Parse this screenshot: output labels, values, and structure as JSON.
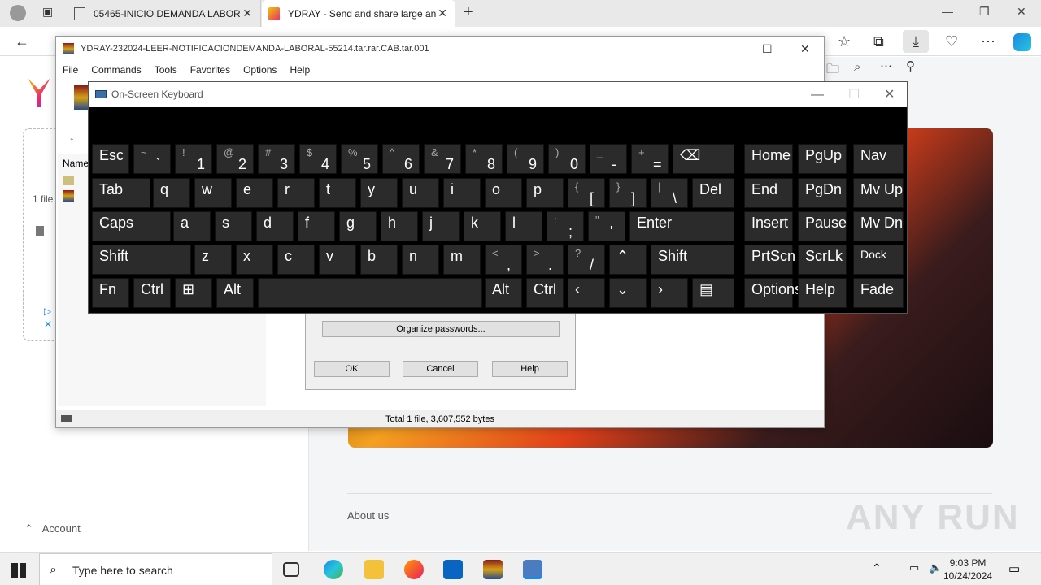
{
  "browser": {
    "tabs": [
      {
        "label": "05465-INICIO DEMANDA LABOR"
      },
      {
        "label": "YDRAY - Send and share large an"
      }
    ]
  },
  "page": {
    "about": "About us",
    "account": "Account",
    "file_count": "1 file",
    "watermark": "ANY RUN"
  },
  "winrar": {
    "title": "YDRAY-232024-LEER-NOTIFICACIONDEMANDA-LABORAL-55214.tar.rar.CAB.tar.001",
    "menu": [
      "File",
      "Commands",
      "Tools",
      "Favorites",
      "Options",
      "Help"
    ],
    "status": "Total 1 file, 3,607,552 bytes",
    "list_header": "Name"
  },
  "dialog": {
    "organize": "Organize passwords...",
    "ok": "OK",
    "cancel": "Cancel",
    "help": "Help"
  },
  "osk": {
    "title": "On-Screen Keyboard"
  },
  "taskbar": {
    "search_placeholder": "Type here to search",
    "time": "9:03 PM",
    "date": "10/24/2024"
  }
}
